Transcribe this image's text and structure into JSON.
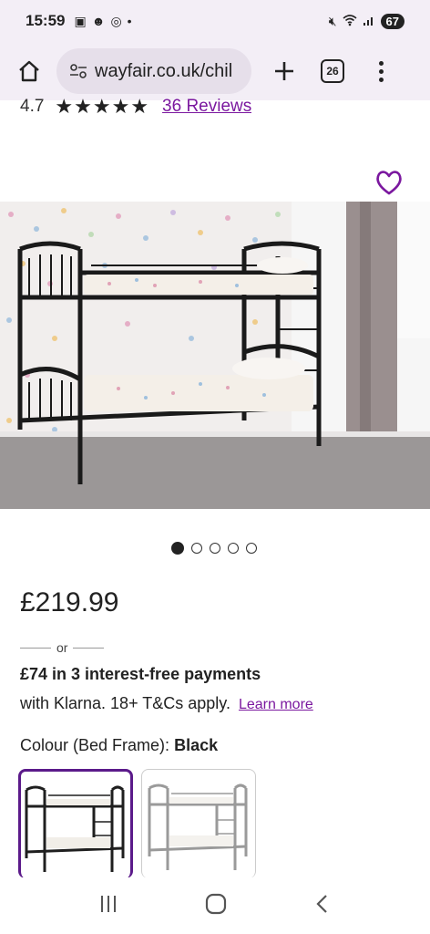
{
  "status_bar": {
    "time": "15:59",
    "left_icons": [
      "screen-record-icon",
      "snapchat-icon",
      "instagram-icon",
      "dot-icon"
    ],
    "right_icons": [
      "mute-icon",
      "wifi-icon",
      "signal-icon"
    ],
    "battery": "67"
  },
  "browser": {
    "url": "wayfair.co.uk/chil",
    "tab_count": "26"
  },
  "product": {
    "rating": "4.7",
    "stars": "★★★★★",
    "reviews_link": "36 Reviews",
    "price": "£219.99",
    "or_text": "or",
    "klarna_line1": "£74 in 3 interest-free payments",
    "klarna_line2": "with Klarna. 18+ T&Cs apply.",
    "learn_more": "Learn more",
    "colour_label": "Colour (Bed Frame):",
    "colour_value": "Black",
    "image_count": 5,
    "active_image": 1
  },
  "swatches": [
    {
      "name": "Black",
      "color": "#1f1f1f",
      "selected": true
    },
    {
      "name": "Silver",
      "color": "#9a9a9a",
      "selected": false
    }
  ],
  "colors": {
    "accent": "#7b189f",
    "selected_border": "#5b1a8a",
    "browser_bg": "#f3eef6"
  }
}
